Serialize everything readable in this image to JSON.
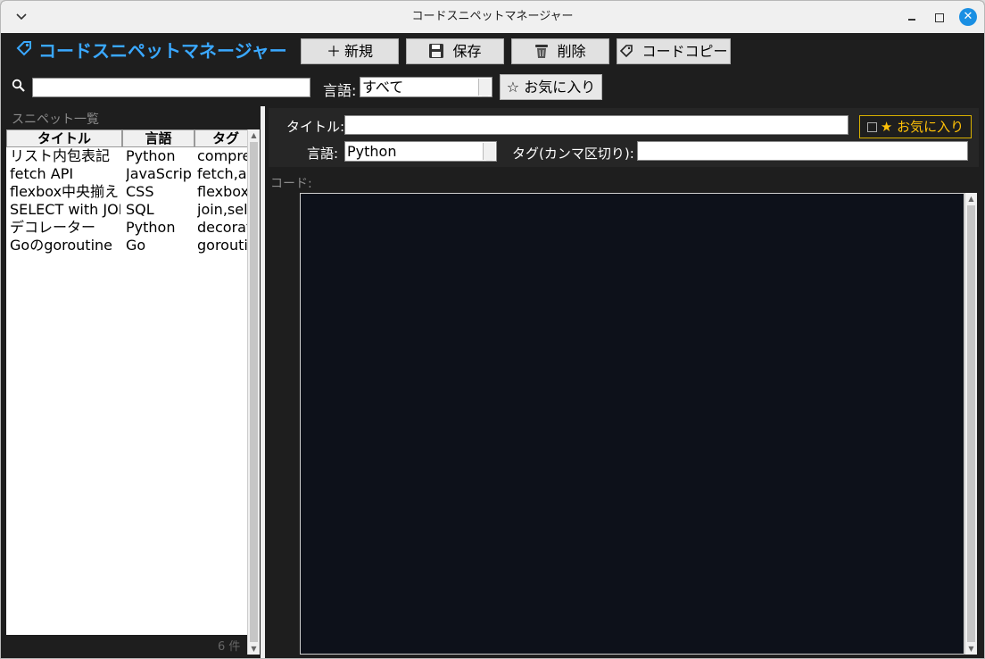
{
  "window": {
    "title": "コードスニペットマネージャー",
    "menu_icon": "chevron-down-icon",
    "close_glyph": "✕"
  },
  "toolbar": {
    "app_title": "コードスニペットマネージャー",
    "app_icon": "tag-icon",
    "accent_color": "#3aa8ff",
    "new_label": "新規",
    "save_label": "保存",
    "delete_label": "削除",
    "copy_label": "コードコピー"
  },
  "filter": {
    "search_value": "",
    "lang_label": "言語:",
    "lang_selected": "すべて",
    "favorite_label": "お気に入り"
  },
  "list": {
    "section_label": "スニペット一覧",
    "columns": [
      "タイトル",
      "言語",
      "タグ"
    ],
    "rows": [
      {
        "title": "リスト内包表記",
        "lang": "Python",
        "tags": "comprehension"
      },
      {
        "title": "fetch API",
        "lang": "JavaScript",
        "tags": "fetch,async"
      },
      {
        "title": "flexbox中央揃え",
        "lang": "CSS",
        "tags": "flexbox"
      },
      {
        "title": "SELECT with JOIN",
        "lang": "SQL",
        "tags": "join,select"
      },
      {
        "title": "デコレーター",
        "lang": "Python",
        "tags": "decorator"
      },
      {
        "title": "Goのgoroutine",
        "lang": "Go",
        "tags": "goroutine"
      }
    ],
    "count": "6 件"
  },
  "form": {
    "title_label": "タイトル:",
    "title_value": "",
    "favorite_label": "★ お気に入り",
    "favorite_color": "#ffc107",
    "lang_label": "言語:",
    "lang_value": "Python",
    "tags_label": "タグ(カンマ区切り):",
    "tags_value": "",
    "code_label": "コード:"
  },
  "editor": {
    "background": "#0d111a",
    "content": ""
  }
}
